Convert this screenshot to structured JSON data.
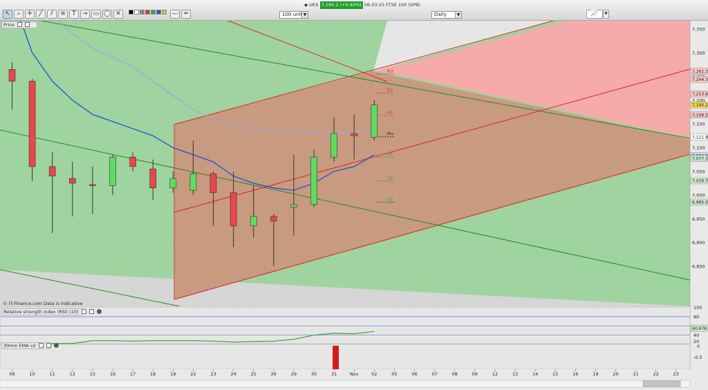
{
  "header": {
    "instrument": "UKX",
    "change": "7,190.2 (+0.92%)",
    "timestamp": "06:33:25 FTSE 100 (SPB)",
    "units": "100 units",
    "period": "Daily"
  },
  "panels": {
    "price": "Price",
    "rsi": "Relative strength index (RSI) (10)",
    "ema": "30min EMA v2"
  },
  "footer_note": "© IT-Finance.com  Data is indicative",
  "colors": {
    "bull_candle": "#5fdc5f",
    "bear_candle": "#e84848",
    "ema_fast": "#1f4fd6",
    "ema_slow": "#9fa8df",
    "red_channel": "#e02020",
    "green_channel": "#208a20",
    "pivot_red": "#d83a3a",
    "pivot_green": "#3a9a3a"
  },
  "chart_data": {
    "type": "candlestick",
    "x_labels": [
      "09",
      "10",
      "11",
      "12",
      "15",
      "16",
      "17",
      "18",
      "19",
      "22",
      "23",
      "24",
      "25",
      "26",
      "29",
      "30",
      "31",
      "Nov",
      "02",
      "05",
      "06",
      "07",
      "08",
      "09",
      "12",
      "13",
      "14",
      "15",
      "16",
      "19",
      "20",
      "21",
      "22",
      "23"
    ],
    "candles": [
      {
        "o": 7265,
        "h": 7280,
        "l": 7180,
        "c": 7240
      },
      {
        "o": 7240,
        "h": 7245,
        "l": 7030,
        "c": 7060
      },
      {
        "o": 7060,
        "h": 7090,
        "l": 6920,
        "c": 7040
      },
      {
        "o": 7035,
        "h": 7070,
        "l": 6955,
        "c": 7025
      },
      {
        "o": 7022,
        "h": 7060,
        "l": 6960,
        "c": 7020
      },
      {
        "o": 7020,
        "h": 7085,
        "l": 7000,
        "c": 7080
      },
      {
        "o": 7080,
        "h": 7090,
        "l": 7050,
        "c": 7060
      },
      {
        "o": 7055,
        "h": 7075,
        "l": 6990,
        "c": 7015
      },
      {
        "o": 7015,
        "h": 7050,
        "l": 7005,
        "c": 7035
      },
      {
        "o": 7010,
        "h": 7115,
        "l": 7000,
        "c": 7045
      },
      {
        "o": 7045,
        "h": 7050,
        "l": 6935,
        "c": 7005
      },
      {
        "o": 7005,
        "h": 7050,
        "l": 6890,
        "c": 6935
      },
      {
        "o": 6935,
        "h": 7020,
        "l": 6910,
        "c": 6955
      },
      {
        "o": 6955,
        "h": 6960,
        "l": 6850,
        "c": 6945
      },
      {
        "o": 6975,
        "h": 7085,
        "l": 6915,
        "c": 6980
      },
      {
        "o": 6980,
        "h": 7095,
        "l": 6975,
        "c": 7080
      },
      {
        "o": 7080,
        "h": 7165,
        "l": 7070,
        "c": 7130
      },
      {
        "o": 7130,
        "h": 7170,
        "l": 7075,
        "c": 7125
      },
      {
        "o": 7122,
        "h": 7200,
        "l": 7115,
        "c": 7190
      }
    ],
    "ema_fast": [
      7420,
      7300,
      7240,
      7200,
      7170,
      7155,
      7140,
      7125,
      7100,
      7085,
      7070,
      7040,
      7025,
      7015,
      7010,
      7025,
      7050,
      7060,
      7085
    ],
    "ema_slow": [
      7440,
      7420,
      7380,
      7340,
      7310,
      7290,
      7270,
      7240,
      7210,
      7180,
      7160,
      7145,
      7140,
      7135,
      7132,
      7130,
      7130,
      7132,
      7135
    ],
    "pivots": [
      {
        "name": "R3",
        "value": 7255
      },
      {
        "name": "R2",
        "value": 7215
      },
      {
        "name": "R1",
        "value": 7168
      },
      {
        "name": "Piv",
        "value": 7123
      },
      {
        "name": "S1",
        "value": 7080
      },
      {
        "name": "S2",
        "value": 7030
      },
      {
        "name": "S3",
        "value": 6985
      }
    ],
    "y_axis_ticks": [
      "7,350",
      "7,300",
      "7,250",
      "7,200",
      "7,150",
      "7,100",
      "7,050",
      "7,000",
      "6,950",
      "6,900",
      "6,850"
    ],
    "ylim": [
      6800,
      7370
    ],
    "price_tags": [
      {
        "label": "7,261.3",
        "value": 7261,
        "color": "#f7c7c7"
      },
      {
        "label": "7,244.3",
        "value": 7244,
        "color": "#f7c7c7"
      },
      {
        "label": "7,213.6",
        "value": 7213,
        "color": "#f7c7c7"
      },
      {
        "label": "7,190.2",
        "value": 7190,
        "color": "#f4d74a"
      },
      {
        "label": "7,169.2",
        "value": 7169,
        "color": "#f7c7c7"
      },
      {
        "label": "7,121.8",
        "value": 7122,
        "color": "#ffffff"
      },
      {
        "label": "7,082.9",
        "value": 7083,
        "color": "#c9d3f5"
      },
      {
        "label": "7,077.1",
        "value": 7077,
        "color": "#cde8cd"
      },
      {
        "label": "7,029.7",
        "value": 7030,
        "color": "#cde8cd"
      },
      {
        "label": "6,985.0",
        "value": 6985,
        "color": "#cde8cd"
      }
    ],
    "rsi": {
      "values": [
        23,
        22,
        22,
        22,
        28,
        28,
        27,
        28,
        28,
        28,
        27,
        25,
        26,
        27,
        31,
        40,
        44,
        43,
        48
      ],
      "last_label": "60.676",
      "ticks": [
        "100",
        "80",
        "40",
        "20"
      ],
      "levels": [
        80,
        60,
        40
      ]
    },
    "ema_panel": {
      "ticks": [
        "0",
        "-0.5"
      ]
    }
  }
}
